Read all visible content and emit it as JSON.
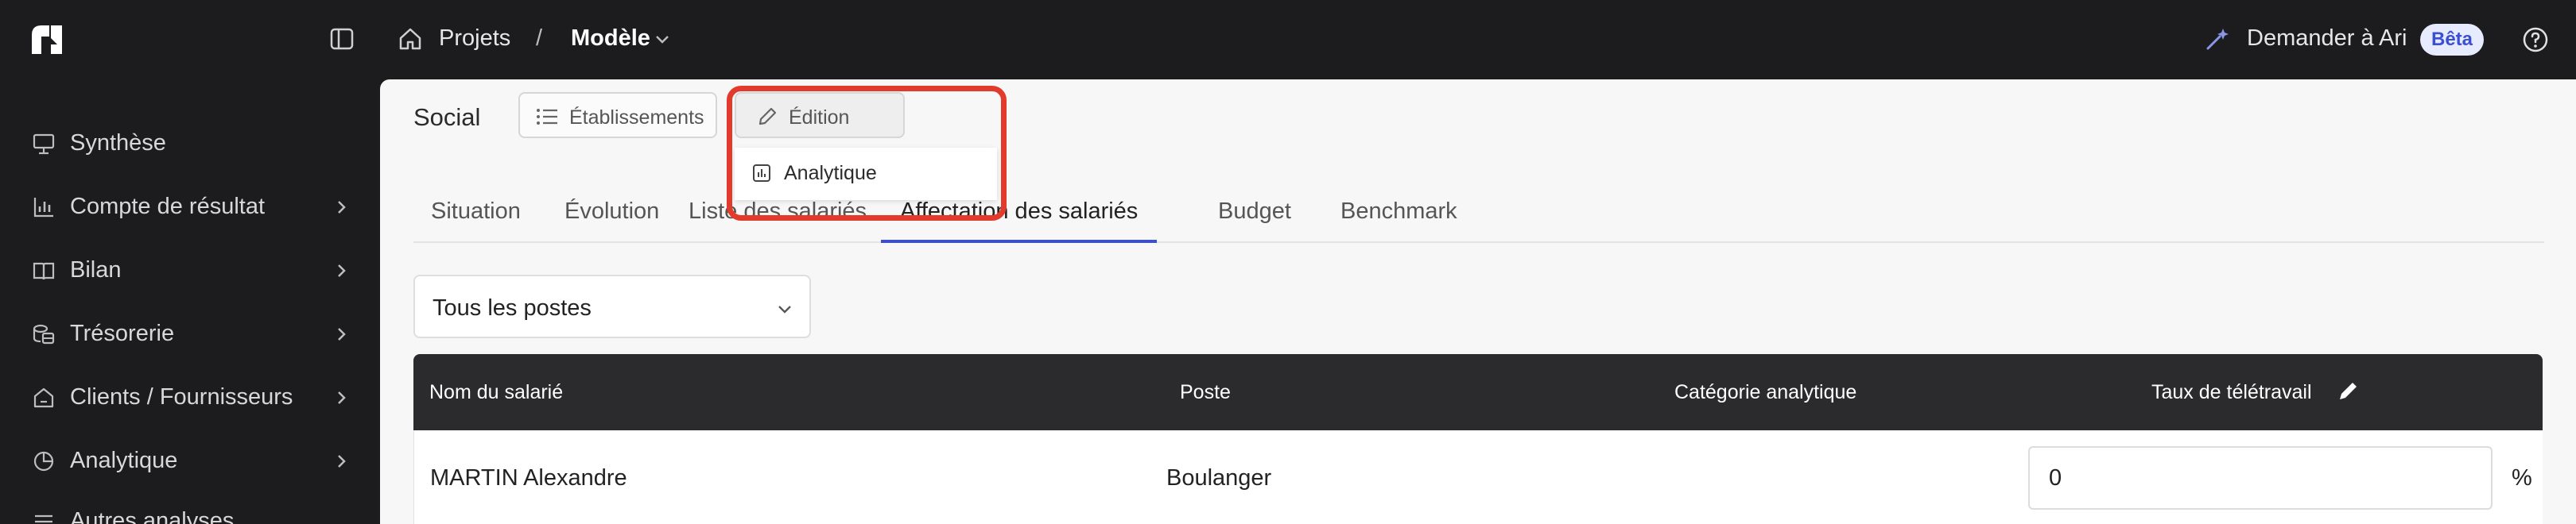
{
  "header": {
    "breadcrumb": [
      "Projets",
      "Modèle"
    ],
    "breadcrumb_separator": "/",
    "ai_label": "Demander à Ari",
    "beta_badge": "Bêta"
  },
  "sidebar": {
    "items": [
      {
        "label": "Synthèse",
        "icon": "presentation-icon",
        "has_chevron": false
      },
      {
        "label": "Compte de résultat",
        "icon": "bar-chart-icon",
        "has_chevron": true
      },
      {
        "label": "Bilan",
        "icon": "book-icon",
        "has_chevron": true
      },
      {
        "label": "Trésorerie",
        "icon": "coins-icon",
        "has_chevron": true
      },
      {
        "label": "Clients / Fournisseurs",
        "icon": "home-icon",
        "has_chevron": true
      },
      {
        "label": "Analytique",
        "icon": "pie-chart-icon",
        "has_chevron": true
      },
      {
        "label": "Autres analyses",
        "icon": "list-icon",
        "has_chevron": true
      }
    ]
  },
  "main": {
    "title": "Social",
    "buttons": {
      "etablissements": "Établissements",
      "edition": "Édition"
    },
    "dropdown_item": "Analytique",
    "tabs": [
      {
        "label": "Situation",
        "active": false
      },
      {
        "label": "Évolution",
        "active": false
      },
      {
        "label": "Liste des salariés",
        "active": false
      },
      {
        "label": "Affectation des salariés",
        "active": true
      },
      {
        "label": "Budget",
        "active": false
      },
      {
        "label": "Benchmark",
        "active": false
      }
    ],
    "filter": {
      "value": "Tous les postes"
    },
    "table": {
      "columns": [
        "Nom du salarié",
        "Poste",
        "Catégorie analytique",
        "Taux de télétravail"
      ],
      "rows": [
        {
          "name": "MARTIN Alexandre",
          "poste": "Boulanger",
          "categorie": "",
          "taux": "0",
          "unit": "%"
        }
      ]
    }
  },
  "colors": {
    "accent": "#3d4fc9",
    "highlight": "#e23b2b",
    "dark": "#1c1c1e"
  }
}
